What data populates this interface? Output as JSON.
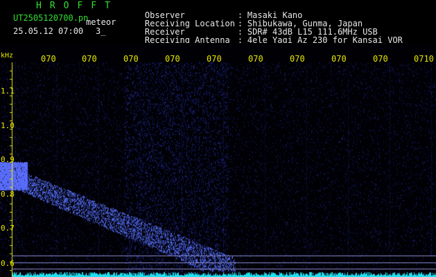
{
  "app": {
    "title": "HROFFT",
    "filename": "UT2505120700.pn",
    "detection_label": "meteor",
    "datetime": "25.05.12 07:00",
    "count": "3_"
  },
  "info": [
    {
      "label": "Observer",
      "value": "Masaki Kano"
    },
    {
      "label": "Receiving Location",
      "value": "Shibukawa, Gunma, Japan"
    },
    {
      "label": "Receiver",
      "value": "SDR# 43dB L15 111.6MHz USB"
    },
    {
      "label": "Receiving Antenna",
      "value": "4ele Yagi Az 230 for Kansai VOR"
    }
  ],
  "time_axis": {
    "labels": [
      "070",
      "070",
      "070",
      "070",
      "070",
      "070",
      "070",
      "070",
      "070",
      "0710"
    ]
  },
  "freq_axis": {
    "unit": "kHz",
    "labels": [
      "1.1",
      "1.0",
      "0.9",
      "0.8",
      "0.7",
      "0.6"
    ]
  },
  "colors": {
    "background": "#000000",
    "header_green": "#2fe02f",
    "axis_yellow": "#e8e800",
    "signal_blue": "#3a50ff",
    "noise_cyan": "#20e0f0"
  }
}
